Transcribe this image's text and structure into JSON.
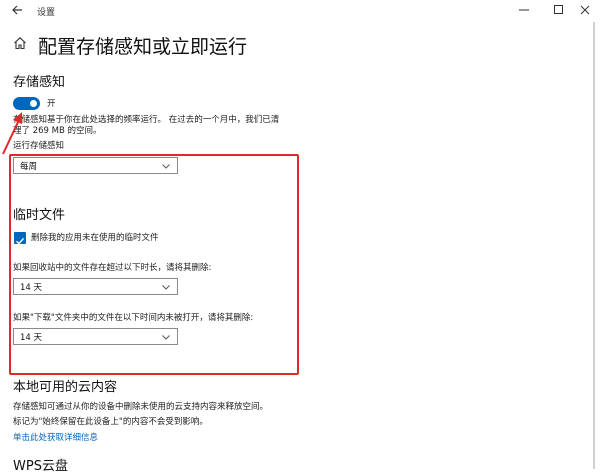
{
  "window": {
    "title": "设置",
    "back_icon": "back-arrow-icon",
    "controls": [
      "minimize-icon",
      "maximize-icon",
      "close-icon"
    ]
  },
  "page": {
    "title": "配置存储感知或立即运行",
    "home_icon": "home-icon"
  },
  "storage_sense": {
    "heading": "存储感知",
    "toggle_state": "开",
    "toggle_on": true,
    "description_line1": "存储感知基于你在此处选择的频率运行。 在过去的一个月中，我们已清",
    "description_line2": "理了 269 MB 的空间。",
    "run_label": "运行存储感知",
    "run_value": "每周"
  },
  "temp_files": {
    "heading": "临时文件",
    "delete_unused_label": "删除我的应用未在使用的临时文件",
    "delete_unused_checked": true,
    "recycle_label": "如果回收站中的文件存在超过以下时长，请将其删除:",
    "recycle_value": "14 天",
    "downloads_label": "如果\"下载\"文件夹中的文件在以下时间内未被打开，请将其删除:",
    "downloads_value": "14 天"
  },
  "cloud": {
    "heading": "本地可用的云内容",
    "description_line1": "存储感知可通过从你的设备中删除未使用的云支持内容来释放空间。",
    "description_line2": "标记为\"始终保留在此设备上\"的内容不会受到影响。",
    "link": "单击此处获取详细信息"
  },
  "wps": {
    "heading": "WPS云盘"
  },
  "colors": {
    "accent": "#0067c0",
    "annotation": "#e02a2a"
  }
}
